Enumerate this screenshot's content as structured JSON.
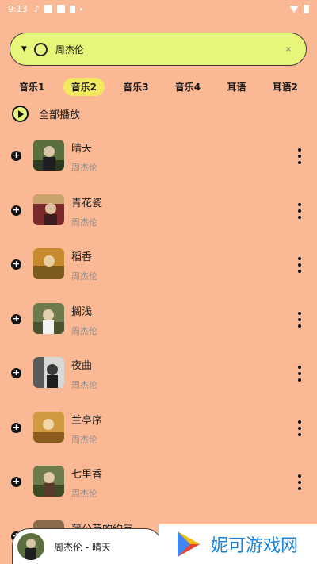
{
  "status_bar": {
    "time": "9:13"
  },
  "search": {
    "query": "周杰伦",
    "clear": "×"
  },
  "tabs": [
    {
      "label": "音乐1",
      "active": false
    },
    {
      "label": "音乐2",
      "active": true
    },
    {
      "label": "音乐3",
      "active": false
    },
    {
      "label": "音乐4",
      "active": false
    },
    {
      "label": "耳语",
      "active": false
    },
    {
      "label": "耳语2",
      "active": false
    }
  ],
  "play_all": {
    "label": "全部播放"
  },
  "songs": [
    {
      "title": "晴天",
      "artist": "周杰伦"
    },
    {
      "title": "青花瓷",
      "artist": "周杰伦"
    },
    {
      "title": "稻香",
      "artist": "周杰伦"
    },
    {
      "title": "搁浅",
      "artist": "周杰伦"
    },
    {
      "title": "夜曲",
      "artist": "周杰伦"
    },
    {
      "title": "兰亭序",
      "artist": "周杰伦"
    },
    {
      "title": "七里香",
      "artist": "周杰伦"
    },
    {
      "title": "蒲公英的约定",
      "artist": ""
    }
  ],
  "mini_player": {
    "now_playing": "周杰伦 - 晴天"
  },
  "watermark": {
    "text": "妮可游戏网"
  },
  "colors": {
    "background": "#FBB894",
    "search_bg": "#E7F57A",
    "active_tab": "#F2E95E",
    "artist_text": "#8e8e8e",
    "watermark_text": "#1a86e0"
  }
}
